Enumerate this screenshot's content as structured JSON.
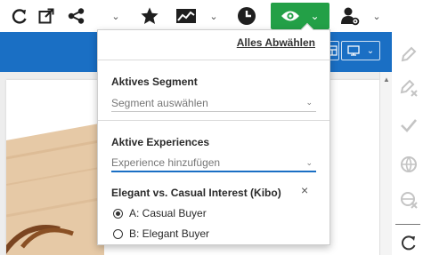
{
  "toolbar": {
    "icons": [
      "refresh-icon",
      "open-external-icon",
      "share-icon",
      "star-icon",
      "analytics-icon",
      "clock-icon",
      "eye-icon",
      "user-settings-icon"
    ],
    "accent_color": "#23a047"
  },
  "dropdown": {
    "deselect_all": "Alles Abwählen",
    "segment": {
      "title": "Aktives Segment",
      "placeholder": "Segment auswählen"
    },
    "experiences": {
      "title": "Aktive Experiences",
      "placeholder": "Experience hinzufügen"
    },
    "experience": {
      "name": "Elegant vs. Casual Interest (Kibo)",
      "remove": "×",
      "options": [
        {
          "label": "A: Casual Buyer",
          "checked": true
        },
        {
          "label": "B: Elegant Buyer",
          "checked": false
        }
      ]
    }
  },
  "app": {
    "header_color": "#1a6fc4"
  }
}
